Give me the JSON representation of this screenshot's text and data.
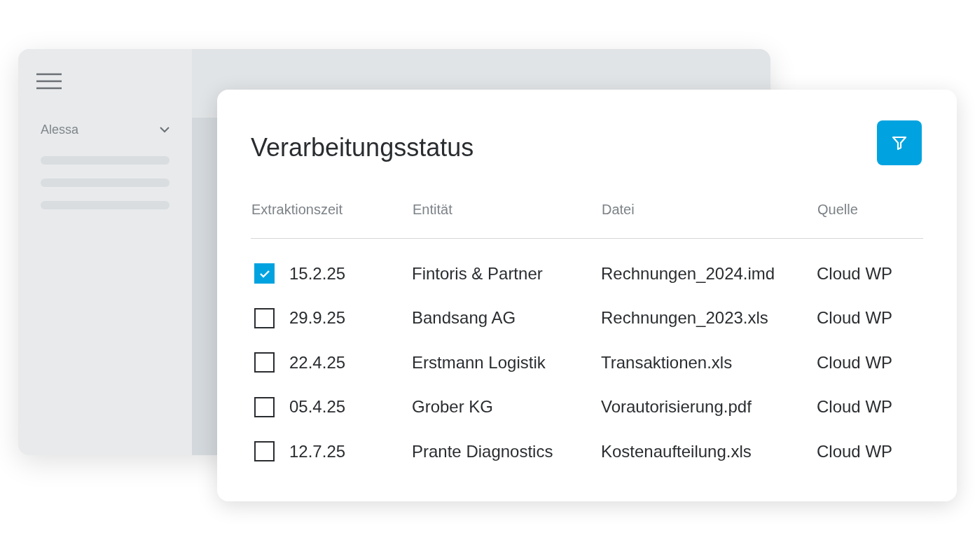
{
  "sidebar": {
    "user": "Alessa"
  },
  "card": {
    "title": "Verarbeitungsstatus",
    "columns": [
      "Extraktionszeit",
      "Entität",
      "Datei",
      "Quelle"
    ],
    "rows": [
      {
        "checked": true,
        "date": "15.2.25",
        "entity": "Fintoris & Partner",
        "file": "Rechnungen_2024.imd",
        "source": "Cloud WP"
      },
      {
        "checked": false,
        "date": "29.9.25",
        "entity": "Bandsang AG",
        "file": "Rechnungen_2023.xls",
        "source": "Cloud WP"
      },
      {
        "checked": false,
        "date": "22.4.25",
        "entity": "Erstmann Logistik",
        "file": "Transaktionen.xls",
        "source": "Cloud WP"
      },
      {
        "checked": false,
        "date": "05.4.25",
        "entity": "Grober KG",
        "file": "Vorautorisierung.pdf",
        "source": "Cloud WP"
      },
      {
        "checked": false,
        "date": "12.7.25",
        "entity": "Prante Diagnostics",
        "file": "Kostenaufteilung.xls",
        "source": "Cloud WP"
      }
    ]
  }
}
